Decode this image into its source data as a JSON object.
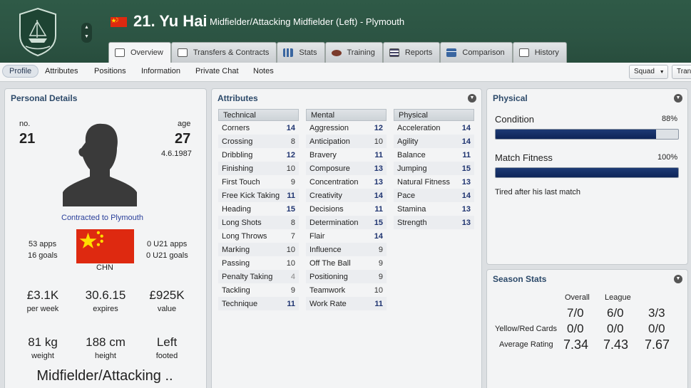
{
  "header": {
    "number_name": "21. Yu Hai",
    "position_club": "Midfielder/Attacking Midfielder (Left) - Plymouth",
    "crest_text": "Plymouth Argyle"
  },
  "tabs": [
    {
      "label": "Overview",
      "icon": "profile-card-icon",
      "active": true
    },
    {
      "label": "Transfers & Contracts",
      "icon": "document-icon"
    },
    {
      "label": "Stats",
      "icon": "bar-chart-icon"
    },
    {
      "label": "Training",
      "icon": "ball-icon"
    },
    {
      "label": "Reports",
      "icon": "report-icon"
    },
    {
      "label": "Comparison",
      "icon": "comparison-icon"
    },
    {
      "label": "History",
      "icon": "history-icon"
    }
  ],
  "subnav": {
    "items": [
      "Profile",
      "Attributes",
      "Positions",
      "Information",
      "Private Chat",
      "Notes"
    ],
    "squad_button": "Squad",
    "trans_button": "Trans"
  },
  "personal": {
    "title": "Personal Details",
    "no_label": "no.",
    "no_value": "21",
    "age_label": "age",
    "age_value": "27",
    "dob": "4.6.1987",
    "contract_text": "Contracted to Plymouth",
    "apps": "53 apps",
    "goals": "16 goals",
    "u21_apps": "0 U21 apps",
    "u21_goals": "0 U21 goals",
    "nation": "CHN",
    "wage": "£3.1K",
    "wage_label": "per week",
    "expires": "30.6.15",
    "expires_label": "expires",
    "value": "£925K",
    "value_label": "value",
    "weight": "81 kg",
    "weight_label": "weight",
    "height": "188 cm",
    "height_label": "height",
    "foot": "Left",
    "foot_label": "footed",
    "position_short": "Midfielder/Attacking .."
  },
  "attributes": {
    "title": "Attributes",
    "technical": {
      "header": "Technical",
      "rows": [
        {
          "name": "Corners",
          "value": "14"
        },
        {
          "name": "Crossing",
          "value": "8"
        },
        {
          "name": "Dribbling",
          "value": "12"
        },
        {
          "name": "Finishing",
          "value": "10"
        },
        {
          "name": "First Touch",
          "value": "9"
        },
        {
          "name": "Free Kick Taking",
          "value": "11"
        },
        {
          "name": "Heading",
          "value": "15"
        },
        {
          "name": "Long Shots",
          "value": "8"
        },
        {
          "name": "Long Throws",
          "value": "7"
        },
        {
          "name": "Marking",
          "value": "10"
        },
        {
          "name": "Passing",
          "value": "10"
        },
        {
          "name": "Penalty Taking",
          "value": "4"
        },
        {
          "name": "Tackling",
          "value": "9"
        },
        {
          "name": "Technique",
          "value": "11"
        }
      ]
    },
    "mental": {
      "header": "Mental",
      "rows": [
        {
          "name": "Aggression",
          "value": "12"
        },
        {
          "name": "Anticipation",
          "value": "10"
        },
        {
          "name": "Bravery",
          "value": "11"
        },
        {
          "name": "Composure",
          "value": "13"
        },
        {
          "name": "Concentration",
          "value": "13"
        },
        {
          "name": "Creativity",
          "value": "14"
        },
        {
          "name": "Decisions",
          "value": "11"
        },
        {
          "name": "Determination",
          "value": "15"
        },
        {
          "name": "Flair",
          "value": "14"
        },
        {
          "name": "Influence",
          "value": "9"
        },
        {
          "name": "Off The Ball",
          "value": "9"
        },
        {
          "name": "Positioning",
          "value": "9"
        },
        {
          "name": "Teamwork",
          "value": "10"
        },
        {
          "name": "Work Rate",
          "value": "11"
        }
      ]
    },
    "physical": {
      "header": "Physical",
      "rows": [
        {
          "name": "Acceleration",
          "value": "14"
        },
        {
          "name": "Agility",
          "value": "14"
        },
        {
          "name": "Balance",
          "value": "11"
        },
        {
          "name": "Jumping",
          "value": "15"
        },
        {
          "name": "Natural Fitness",
          "value": "13"
        },
        {
          "name": "Pace",
          "value": "14"
        },
        {
          "name": "Stamina",
          "value": "13"
        },
        {
          "name": "Strength",
          "value": "13"
        }
      ]
    }
  },
  "physical_panel": {
    "title": "Physical",
    "condition_label": "Condition",
    "condition_value": "88%",
    "condition_fraction": 0.88,
    "fitness_label": "Match Fitness",
    "fitness_value": "100%",
    "fitness_fraction": 1.0,
    "note": "Tired after his last match"
  },
  "season_stats": {
    "title": "Season Stats",
    "col_overall": "Overall",
    "col_league": "League",
    "apps_row": [
      "7/0",
      "6/0",
      "3/3"
    ],
    "cards_label": "Yellow/Red Cards",
    "cards_row": [
      "0/0",
      "0/0",
      "0/0"
    ],
    "rating_label": "Average Rating",
    "rating_row": [
      "7.34",
      "7.43",
      "7.67"
    ]
  },
  "colors": {
    "header_bg": "#2c5443",
    "accent_blue": "#1f3470",
    "bar_fill": "#0e2559",
    "china_red": "#de2910"
  }
}
